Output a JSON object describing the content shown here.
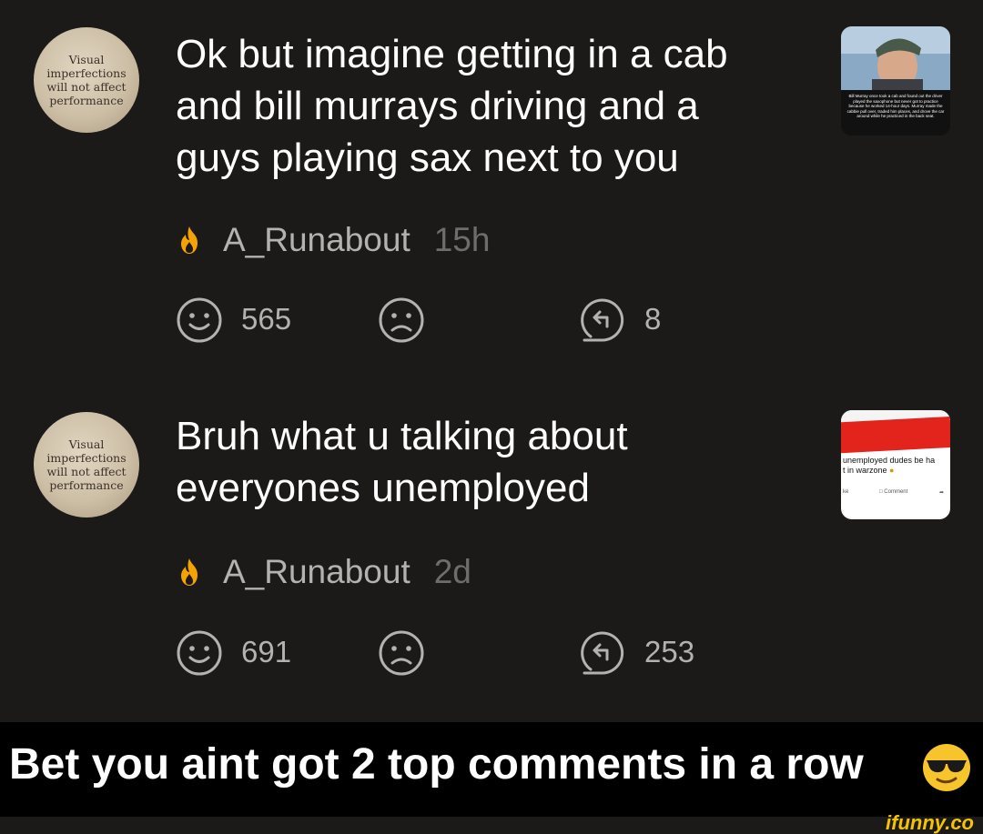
{
  "comments": [
    {
      "avatar_text": [
        "Visual",
        "imperfections",
        "will not affect",
        "performance"
      ],
      "text_lines": [
        "Ok but imagine getting in a cab",
        "and bill murrays driving and a",
        "guys playing sax next to you"
      ],
      "username": "A_Runabout",
      "time": "15h",
      "upvotes": "565",
      "replies": "8",
      "thumb_caption": "Bill Murray once took a cab and found out the driver played the saxophone but never got to practice because he worked 14-hour days. Murray made the cabbie pull over, traded him places, and drove the car around while he practiced in the back seat."
    },
    {
      "avatar_text": [
        "Visual",
        "imperfections",
        "will not affect",
        "performance"
      ],
      "text_lines": [
        "Bruh what u talking about",
        "everyones unemployed"
      ],
      "username": "A_Runabout",
      "time": "2d",
      "upvotes": "691",
      "replies": "253",
      "thumb_caption_1": "unemployed dudes be ha",
      "thumb_caption_2": "t in warzone",
      "thumb_like": "ke",
      "thumb_comment": "Comment"
    }
  ],
  "banner": {
    "text": "Bet you aint got 2 top comments in a row"
  },
  "brand": "ifunny.co",
  "colors": {
    "background": "#1c1a19",
    "text": "#ffffff",
    "meta": "#b4b2b0",
    "muted": "#6f6c6a",
    "fire": "#f5a300",
    "brand": "#f5c400"
  }
}
